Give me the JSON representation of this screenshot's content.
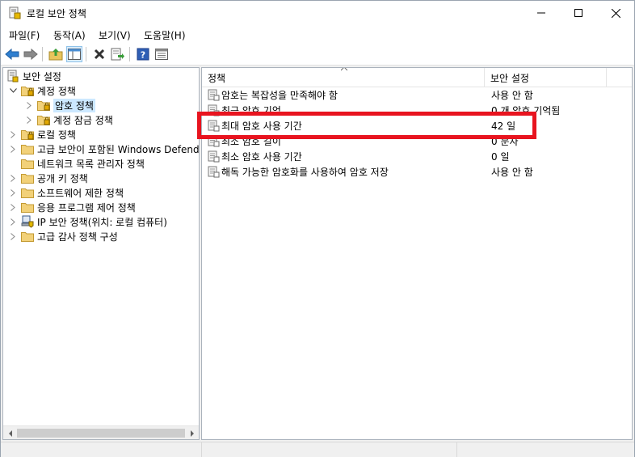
{
  "window": {
    "title": "로컬 보안 정책"
  },
  "menu": [
    "파일(F)",
    "동작(A)",
    "보기(V)",
    "도움말(H)"
  ],
  "toolbar_icons": [
    "back-arrow-icon",
    "forward-arrow-icon",
    "up-folder-icon",
    "show-hide-tree-icon",
    "delete-icon",
    "export-list-icon",
    "help-icon",
    "properties-icon"
  ],
  "tree": {
    "root": "보안 설정",
    "items": [
      {
        "label": "계정 정책",
        "level": 1,
        "expanded": true,
        "icon": "folder-lock-icon"
      },
      {
        "label": "암호 정책",
        "level": 2,
        "expanded": false,
        "icon": "folder-lock-icon",
        "selected": true
      },
      {
        "label": "계정 잠금 정책",
        "level": 2,
        "expanded": false,
        "icon": "folder-lock-icon"
      },
      {
        "label": "로컬 정책",
        "level": 1,
        "expanded": false,
        "icon": "folder-lock-icon"
      },
      {
        "label": "고급 보안이 포함된 Windows Defende",
        "level": 1,
        "expanded": false,
        "icon": "folder-icon"
      },
      {
        "label": "네트워크 목록 관리자 정책",
        "level": 1,
        "expanded": null,
        "icon": "folder-icon"
      },
      {
        "label": "공개 키 정책",
        "level": 1,
        "expanded": false,
        "icon": "folder-icon"
      },
      {
        "label": "소프트웨어 제한 정책",
        "level": 1,
        "expanded": false,
        "icon": "folder-icon"
      },
      {
        "label": "응용 프로그램 제어 정책",
        "level": 1,
        "expanded": false,
        "icon": "folder-icon"
      },
      {
        "label": "IP 보안 정책(위치: 로컬 컴퓨터)",
        "level": 1,
        "expanded": false,
        "icon": "ip-security-icon"
      },
      {
        "label": "고급 감사 정책 구성",
        "level": 1,
        "expanded": false,
        "icon": "folder-icon"
      }
    ]
  },
  "list": {
    "columns": [
      "정책",
      "보안 설정"
    ],
    "rows": [
      {
        "name": "암호는 복잡성을 만족해야 함",
        "value": "사용 안 함"
      },
      {
        "name": "최근 암호 기억",
        "value": "0 개 암호 기억됨"
      },
      {
        "name": "최대 암호 사용 기간",
        "value": "42 일"
      },
      {
        "name": "최소 암호 길이",
        "value": "0 문자"
      },
      {
        "name": "최소 암호 사용 기간",
        "value": "0 일"
      },
      {
        "name": "해독 가능한 암호화를 사용하여 암호 저장",
        "value": "사용 안 함"
      }
    ]
  },
  "colors": {
    "highlight_border": "#e8141f",
    "selection": "#cce8ff"
  }
}
